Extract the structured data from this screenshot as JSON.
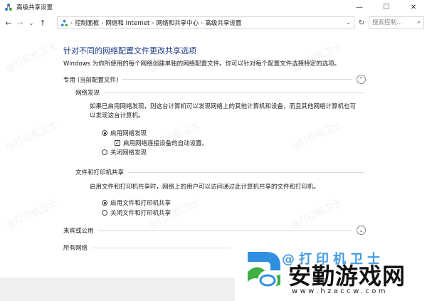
{
  "window": {
    "title": "高级共享设置",
    "minimize_glyph": "—",
    "maximize_glyph": "☐",
    "close_glyph": "✕"
  },
  "nav": {
    "back_glyph": "←",
    "forward_glyph": "→",
    "recent_glyph": "⌄",
    "up_glyph": "↑",
    "breadcrumb": [
      "控制面板",
      "网络和 Internet",
      "网络和共享中心",
      "高级共享设置"
    ],
    "separator": "›",
    "dropdown_glyph": "⌄",
    "refresh_glyph": "↻",
    "search_placeholder": "搜索控制...",
    "search_glyph": "⌕"
  },
  "content": {
    "title": "针对不同的网络配置文件更改共享选项",
    "description": "Windows 为你所使用的每个网络创建单独的网络配置文件。你可以针对每个配置文件选择特定的选项。",
    "private_profile": {
      "label": "专用 (当前配置文件)",
      "chevron": "⌃",
      "network_discovery": {
        "heading": "网络发现",
        "text": "如果已启用网络发现，则这台计算机可以发现网络上的其他计算机和设备，而且其他网络计算机也可以发现这台计算机。",
        "options": [
          {
            "label": "启用网络发现",
            "selected": true
          },
          {
            "label": "启用网络连接设备的自动设置。",
            "checked": true
          },
          {
            "label": "关闭网络发现",
            "selected": false
          }
        ]
      },
      "file_printer_sharing": {
        "heading": "文件和打印机共享",
        "text": "启用文件和打印机共享时，网络上的用户可以访问通过此计算机共享的文件和打印机。",
        "options": [
          {
            "label": "启用文件和打印机共享",
            "selected": true
          },
          {
            "label": "关闭文件和打印机共享",
            "selected": false
          }
        ]
      }
    },
    "guest_profile": {
      "label": "来宾或公用",
      "chevron": "⌄"
    },
    "all_networks": {
      "label": "所有网络"
    }
  },
  "watermark": {
    "brand_text": "安勤游戏网",
    "url": "www.hzaccw.com",
    "faint_text": "@打印机卫士"
  },
  "colors": {
    "title_blue": "#1e3a8a",
    "logo_blue": "#2f8fe0",
    "logo_green": "#3cb043"
  }
}
